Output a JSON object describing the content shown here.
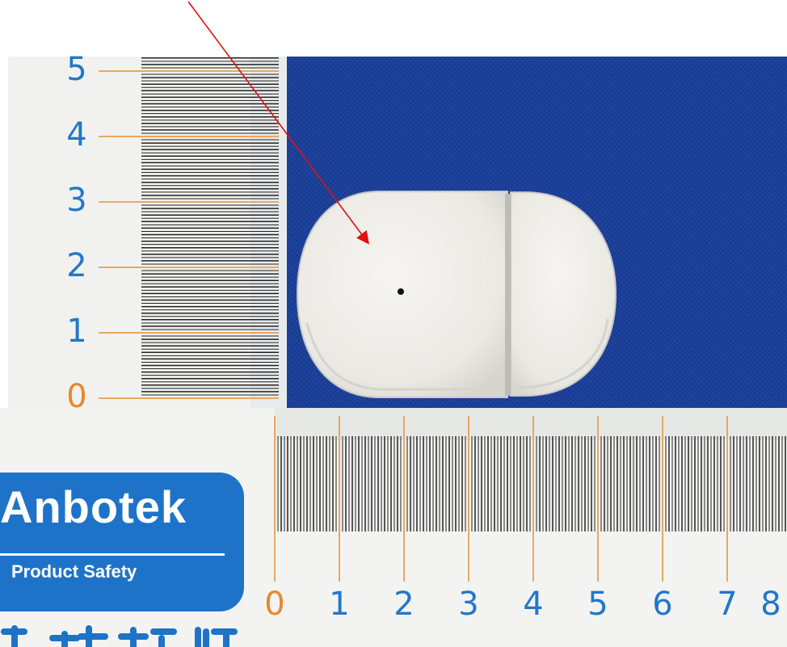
{
  "scene": {
    "description_hidden": "",
    "colors": {
      "cloth": "#1b3f9a",
      "ruler": "#f2f3f1",
      "tick": "#222222",
      "orange_line": "#e8a860",
      "blue_digit": "#2377c9",
      "orange_digit": "#e58a2b",
      "device": "#efeeea",
      "arrow": "#e01010",
      "brand": "#1e73c8"
    }
  },
  "vertical_ruler": {
    "labels": [
      "0",
      "1",
      "2",
      "3",
      "4",
      "5"
    ]
  },
  "horizontal_ruler": {
    "labels": [
      "0",
      "1",
      "2",
      "3",
      "4",
      "5",
      "6",
      "7",
      "8"
    ]
  },
  "brand": {
    "name": "Anbotek",
    "tagline": "Product Safety",
    "chinese_text": "安博检测"
  },
  "device": {
    "icon": "door-window-sensor-icon"
  }
}
